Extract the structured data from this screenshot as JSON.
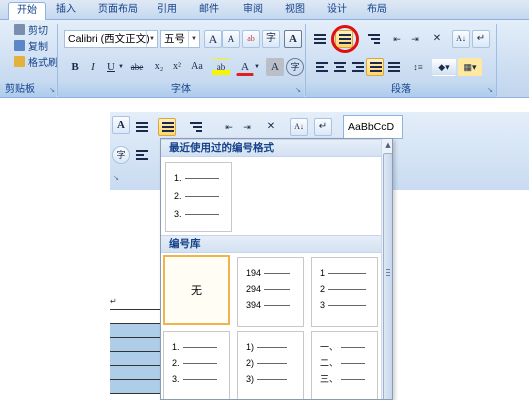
{
  "tabs": [
    {
      "label": "开始",
      "active": true
    },
    {
      "label": "插入",
      "active": false
    },
    {
      "label": "页面布局",
      "active": false
    },
    {
      "label": "引用",
      "active": false
    },
    {
      "label": "邮件",
      "active": false
    },
    {
      "label": "审阅",
      "active": false
    },
    {
      "label": "视图",
      "active": false
    },
    {
      "label": "设计",
      "active": false
    },
    {
      "label": "布局",
      "active": false
    }
  ],
  "clipboard": {
    "cut": "剪切",
    "copy": "复制",
    "format_painter": "格式刷",
    "label": "剪贴板"
  },
  "font": {
    "name": "Calibri (西文正文)",
    "size": "五号",
    "label": "字体",
    "grow": "A",
    "shrink": "A",
    "bold": "B",
    "italic": "I",
    "underline": "U",
    "strike": "abe",
    "subscript": "x₂",
    "superscript": "x²",
    "case": "Aa",
    "color_a": "A",
    "border_a": "A",
    "phonetic": "字"
  },
  "paragraph": {
    "label": "段落"
  },
  "styles": {
    "preview": "AaBbCcD"
  },
  "dropdown": {
    "recent_header": "最近使用过的编号格式",
    "library_header": "编号库",
    "recent": [
      {
        "lines": [
          "1.",
          "2.",
          "3."
        ]
      }
    ],
    "library": [
      {
        "none_label": "无",
        "selected": true
      },
      {
        "lines": [
          "194",
          "294",
          "394"
        ]
      },
      {
        "lines": [
          "1",
          "2",
          "3"
        ]
      },
      {
        "lines": [
          "1.",
          "2.",
          "3."
        ]
      },
      {
        "lines": [
          "1)",
          "2)",
          "3)"
        ]
      },
      {
        "lines": [
          "一、",
          "二、",
          "三、"
        ]
      }
    ]
  },
  "colors": {
    "highlight_circle": "#e01010",
    "selected_border": "#f0b44b",
    "ribbon_blue": "#15428b"
  }
}
